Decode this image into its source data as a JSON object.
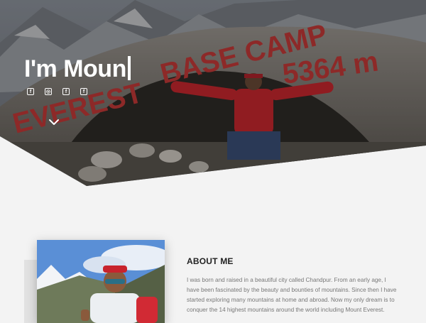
{
  "hero": {
    "title": "I'm Moun",
    "rock_text_1": "BASE CAMP",
    "rock_text_2": "EVEREST",
    "rock_text_3": "5364 m",
    "social_icons": [
      "facebook-icon",
      "instagram-icon",
      "facebook-icon",
      "facebook-icon"
    ],
    "social_glyphs": [
      "f",
      "◎",
      "f",
      "f"
    ],
    "scroll_icon": "chevron-down-icon"
  },
  "about": {
    "heading": "ABOUT ME",
    "text": "I was born and raised in a beautiful city called Chandpur. From an early age, I have been fascinated by the beauty and bounties of mountains. Since then I have started exploring many mountains at home and abroad. Now my only dream is to conquer the 14 highest mountains around the world including Mount Everest."
  },
  "colors": {
    "background": "#f3f3f3",
    "heading": "#222222",
    "body_text": "#777777",
    "rock_paint": "#c43a38"
  }
}
